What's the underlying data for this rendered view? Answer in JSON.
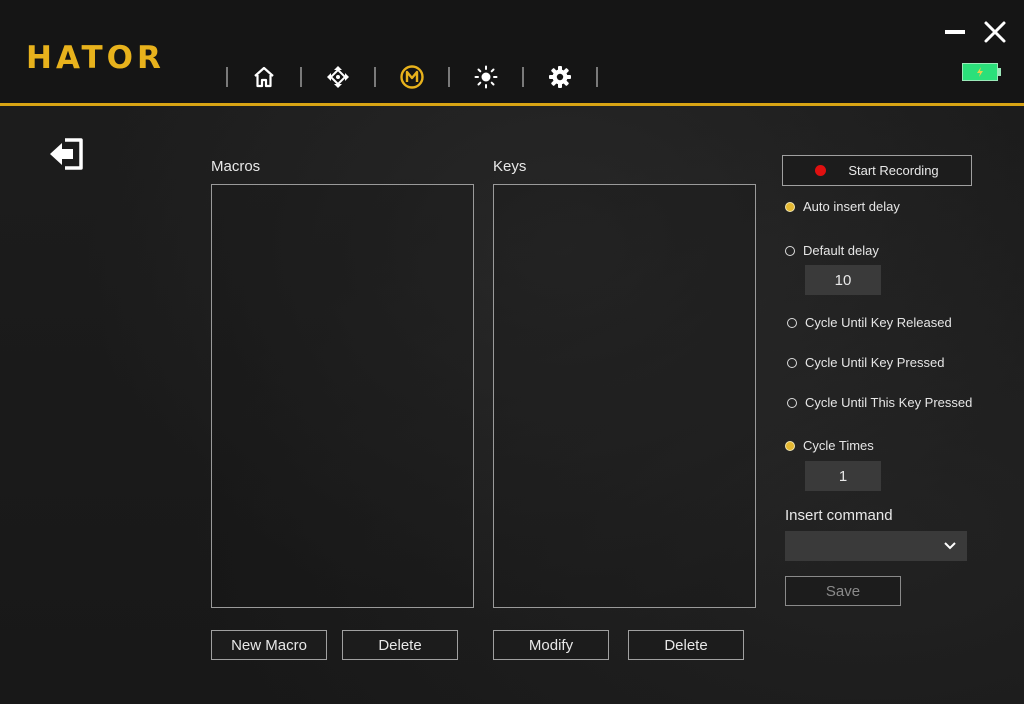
{
  "app": {
    "brand": "HATOR",
    "accent": "#d8a414"
  },
  "nav": {
    "items": [
      {
        "name": "home",
        "icon": "home-icon"
      },
      {
        "name": "dpi",
        "icon": "move-arrows-icon"
      },
      {
        "name": "macro",
        "icon": "macro-m-icon",
        "active": true
      },
      {
        "name": "lighting",
        "icon": "brightness-icon"
      },
      {
        "name": "settings",
        "icon": "gear-icon"
      }
    ]
  },
  "window": {
    "battery_color": "#2be07a"
  },
  "macros": {
    "title": "Macros",
    "new_label": "New Macro",
    "delete_label": "Delete"
  },
  "keys": {
    "title": "Keys",
    "modify_label": "Modify",
    "delete_label": "Delete"
  },
  "recording": {
    "start_label": "Start Recording",
    "auto_delay": "Auto insert delay",
    "default_delay": "Default delay",
    "default_delay_value": "10",
    "cycle_released": "Cycle Until Key Released",
    "cycle_pressed": "Cycle Until Key Pressed",
    "cycle_this_pressed": "Cycle Until This Key Pressed",
    "cycle_times": "Cycle Times",
    "cycle_times_value": "1",
    "insert_command": "Insert command",
    "insert_command_value": "",
    "save_label": "Save"
  }
}
